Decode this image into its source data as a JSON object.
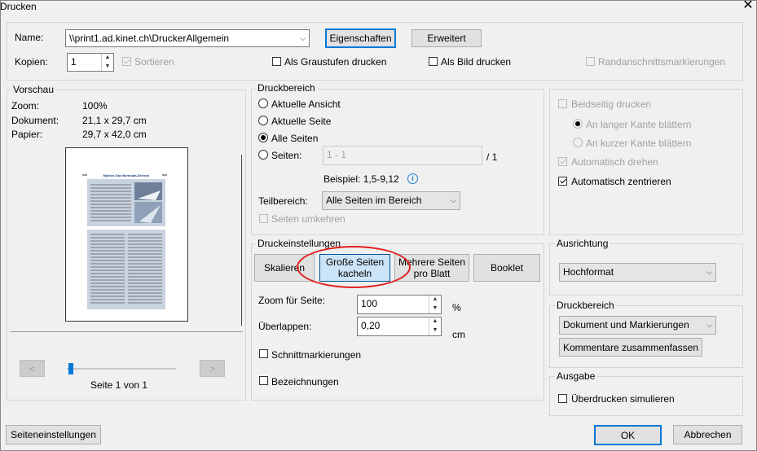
{
  "window": {
    "title": "Drucken",
    "close_glyph": "✕"
  },
  "printer": {
    "name_label": "Name:",
    "name_value": "\\\\print1.ad.kinet.ch\\DruckerAllgemein",
    "properties_button": "Eigenschaften",
    "advanced_button": "Erweitert",
    "copies_label": "Kopien:",
    "copies_value": "1",
    "collate_label": "Sortieren",
    "grayscale_label": "Als Graustufen drucken",
    "as_image_label": "Als Bild drucken",
    "crop_marks_label": "Randanschnittsmarkierungen"
  },
  "preview": {
    "legend": "Vorschau",
    "zoom_label": "Zoom:",
    "zoom_value": "100%",
    "document_label": "Dokument:",
    "document_value": "21,1 x 29,7 cm",
    "paper_label": "Papier:",
    "paper_value": "29,7 x 42,0 cm",
    "prev_glyph": "<",
    "next_glyph": ">",
    "page_status": "Seite 1 von 1",
    "page_heading": "Mythos Das Bermuda-Dreieck"
  },
  "print_range": {
    "legend": "Druckbereich",
    "current_view": "Aktuelle Ansicht",
    "current_page": "Aktuelle Seite",
    "all_pages": "Alle Seiten",
    "pages": "Seiten:",
    "pages_value": "1 - 1",
    "pages_total": "/ 1",
    "example": "Beispiel: 1,5-9,12",
    "subset_label": "Teilbereich:",
    "subset_value": "Alle Seiten im Bereich",
    "reverse_label": "Seiten umkehren"
  },
  "duplex": {
    "both_sides": "Beidseitig drucken",
    "long_edge": "An langer Kante blättern",
    "short_edge": "An kurzer Kante blättern",
    "auto_rotate": "Automatisch drehen",
    "auto_center": "Automatisch zentrieren"
  },
  "print_settings": {
    "legend": "Druckeinstellungen",
    "scale_button": "Skalieren",
    "tile_button_line1": "Große Seiten",
    "tile_button_line2": "kacheln",
    "multiple_button_line1": "Mehrere Seiten",
    "multiple_button_line2": "pro Blatt",
    "booklet_button": "Booklet",
    "zoom_label": "Zoom für Seite:",
    "zoom_value": "100",
    "zoom_unit": "%",
    "overlap_label": "Überlappen:",
    "overlap_value": "0,20",
    "overlap_unit": "cm",
    "cut_marks_label": "Schnittmarkierungen",
    "labels_label": "Bezeichnungen"
  },
  "orientation": {
    "legend": "Ausrichtung",
    "value": "Hochformat"
  },
  "comments": {
    "legend": "Druckbereich",
    "value": "Dokument und Markierungen",
    "summarize_button": "Kommentare zusammenfassen"
  },
  "output": {
    "legend": "Ausgabe",
    "simulate_overprint": "Überdrucken simulieren"
  },
  "footer": {
    "page_setup_button": "Seiteneinstellungen",
    "ok_button": "OK",
    "cancel_button": "Abbrechen"
  },
  "colors": {
    "accent": "#0078d7",
    "highlight_circle": "#e02020",
    "pressed_fill": "#cce4f7"
  }
}
